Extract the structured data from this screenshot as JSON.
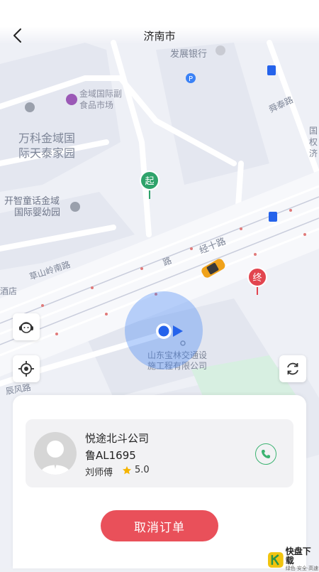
{
  "header": {
    "title": "济南市"
  },
  "map": {
    "labels": {
      "bank": "发展银行",
      "market": "金域国际副\n食品市场",
      "complex": "万科金域国\n际天泰家园",
      "kindergarten": "开智童话金域\n国际婴幼园",
      "road_jingshi": "经十路",
      "road_lu": "路",
      "road_caoshan": "草山岭南路",
      "road_shunhua": "舜泰路",
      "road_chenfeng": "辰风路",
      "company_label": "山东宝林交通设\n施工程有限公司",
      "hotel_fragment": "酒店",
      "right_edge": "国\n权\n济"
    },
    "markers": {
      "start": "起",
      "end": "终"
    }
  },
  "order_card": {
    "company": "悦途北斗公司",
    "plate": "鲁AL1695",
    "driver": "刘师傅",
    "rating": "5.0",
    "cancel_label": "取消订单"
  },
  "logo": {
    "text": "快盘下载",
    "sub": "绿色·安全·高速"
  },
  "colors": {
    "accent": "#e9505a",
    "start_marker": "#2fa36b",
    "end_marker": "#e2454f",
    "location_blue": "#3b82f6"
  }
}
